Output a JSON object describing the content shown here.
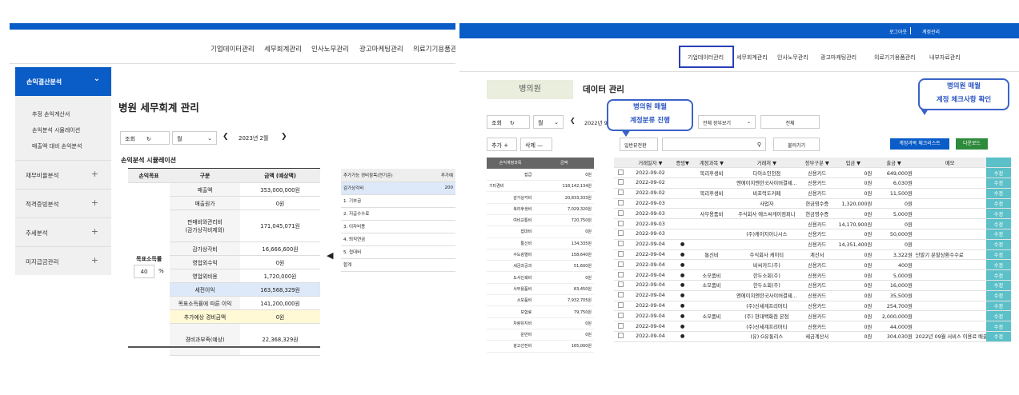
{
  "left": {
    "nav": [
      "기업데이터관리",
      "세무회계관리",
      "인사노무관리",
      "광고마케팅관리",
      "의료기기용품관리"
    ],
    "sidebar": {
      "active": "손익결산분석",
      "sub": [
        "추정 손익계산서",
        "손익분석 시뮬레이션",
        "매출액 대비 손익분석"
      ],
      "sections": [
        "재무비율분석",
        "적격증빙분석",
        "추세분석",
        "미지급금관리"
      ]
    },
    "title": "병원 세무회계 관리",
    "controls": {
      "query": "조회",
      "period": "월",
      "month": "2023년 2월"
    },
    "sim_title": "손익분석 시뮬레이션",
    "sim_headers": [
      "손익목표",
      "구분",
      "금액 (예상액)"
    ],
    "target_label": "목표소득률",
    "target_value": "40",
    "target_unit": "%",
    "sim_rows": [
      [
        "매출액",
        "353,000,000원"
      ],
      [
        "매출원가",
        "0원"
      ],
      [
        "판매비와관리비\n(감가상각비제외)",
        "171,045,071원"
      ],
      [
        "감가상각비",
        "16,666,600원"
      ],
      [
        "영업외수익",
        "0원"
      ],
      [
        "영업외비용",
        "1,720,000원"
      ],
      [
        "세전이익",
        "163,568,329원"
      ],
      [
        "목표소득률에 따른 이익",
        "141,200,000원"
      ],
      [
        "추가예상 경비금액",
        "0원"
      ],
      [
        "경비과부족(예상)",
        "22,368,329원"
      ]
    ],
    "extra_headers": [
      "추가가능 경비항목(연기준)",
      "추가예"
    ],
    "extra_rows": [
      "감가상각비",
      "1. 기부금",
      "2. 지급수수료",
      "3. 이자비용",
      "4. 퇴직연금",
      "5. 접대비",
      "합계"
    ],
    "extra_first_value": "200"
  },
  "right": {
    "logout": "로그아웃",
    "account": "계정관리",
    "nav": [
      "기업데이터관리",
      "세무회계관리",
      "인사노무관리",
      "광고마케팅관리",
      "의료기기용품관리",
      "내부자료관리"
    ],
    "hospital": "병의원",
    "data_title": "데이터 관리",
    "bubble1": [
      "병의원 매월",
      "계정분류 진행"
    ],
    "bubble2": [
      "병의원 매월",
      "계정 체크사항 확인"
    ],
    "controls": {
      "query": "조회",
      "period": "월",
      "month": "2022년 9",
      "voucher": "전체 장부보기",
      "all": "전체",
      "add": "추가 +",
      "delete": "삭제 —",
      "convert": "일반뷰전환",
      "search_btn": "불러가기",
      "check_btn": "계정과목 체크리스트",
      "download": "다운로드"
    },
    "left_headers": [
      "손익계정과목",
      "금액"
    ],
    "left_rows": [
      [
        "접급",
        "0원"
      ],
      [
        "기타경비",
        "118,142,134원"
      ],
      [
        "감가상각비",
        "20,833,333원"
      ],
      [
        "복리후생비",
        "7,029,320원"
      ],
      [
        "여비교통비",
        "720,750원"
      ],
      [
        "접대비",
        "0원"
      ],
      [
        "통신비",
        "134,335원"
      ],
      [
        "수도광열비",
        "158,640원"
      ],
      [
        "세금과공과",
        "51,600원"
      ],
      [
        "도서인쇄비",
        "0원"
      ],
      [
        "사무용품비",
        "83,450원"
      ],
      [
        "소모품비",
        "7,932,705원"
      ],
      [
        "보험료",
        "79,750원"
      ],
      [
        "차량유지비",
        "0원"
      ],
      [
        "운반비",
        "0원"
      ],
      [
        "광고선전비",
        "165,000원"
      ]
    ],
    "headers": [
      "거래일자 ▼",
      "증빙▼",
      "계정과목 ▼",
      "거래처 ▼",
      "장부구분 ▼",
      "입금 ▼",
      "출금 ▼",
      "메모",
      ""
    ],
    "rows": [
      [
        "2022-09-02",
        "",
        "복리후생비",
        "다이소인천점",
        "신용카드",
        "0원",
        "649,000원",
        ""
      ],
      [
        "2022-09-02",
        "",
        "",
        "엔에이치엔한국사이버결제...",
        "신용카드",
        "0원",
        "6,030원",
        ""
      ],
      [
        "2022-09-02",
        "",
        "복리후생비",
        "비포럭도커페",
        "신용카드",
        "0원",
        "11,500원",
        ""
      ],
      [
        "2022-09-03",
        "",
        "",
        "사업자",
        "현금영수증",
        "1,320,000원",
        "0원",
        ""
      ],
      [
        "2022-09-03",
        "",
        "사무용품비",
        "주식회사 에스씨게이컴퍼니",
        "현금영수증",
        "0원",
        "5,000원",
        ""
      ],
      [
        "2022-09-03",
        "",
        "",
        "",
        "신용카드",
        "14,170,900원",
        "0원",
        ""
      ],
      [
        "2022-09-03",
        "",
        "",
        "(주)케이지이니시스",
        "신용카드",
        "0원",
        "50,000원",
        ""
      ],
      [
        "2022-09-04",
        "●",
        "",
        "",
        "신용카드",
        "14,351,400원",
        "0원",
        ""
      ],
      [
        "2022-09-04",
        "●",
        "통신비",
        "주식회사 케이티",
        "계산서",
        "0원",
        "3,322원",
        "단말기 분할상환수수료"
      ],
      [
        "2022-09-04",
        "●",
        "",
        "비씨카드(주)",
        "신용카드",
        "0원",
        "400원",
        ""
      ],
      [
        "2022-09-04",
        "●",
        "소모품비",
        "한두소회(주)",
        "신용카드",
        "0원",
        "5,000원",
        ""
      ],
      [
        "2022-09-04",
        "●",
        "소모품비",
        "한두소회(주)",
        "신용카드",
        "0원",
        "16,000원",
        ""
      ],
      [
        "2022-09-04",
        "●",
        "",
        "엔에이치엔한국사이버결제...",
        "신용카드",
        "0원",
        "35,500원",
        ""
      ],
      [
        "2022-09-04",
        "●",
        "",
        "(주)신세계프리머티",
        "신용카드",
        "0원",
        "254,700원",
        ""
      ],
      [
        "2022-09-04",
        "●",
        "소모품비",
        "(주) 현대백화점 본점",
        "신용카드",
        "0원",
        "2,000,000원",
        ""
      ],
      [
        "2022-09-04",
        "●",
        "",
        "(주)신세계프리머티",
        "신용카드",
        "0원",
        "44,000원",
        ""
      ],
      [
        "2022-09-04",
        "●",
        "",
        "(유) G유통리스",
        "세금계산서",
        "0원",
        "304,030원",
        "2022년 09월 서비스 이용료 배출"
      ]
    ],
    "edit_label": "수정"
  },
  "colors": {
    "primary": "#0a5cc7",
    "teal": "#5bc0c8",
    "green": "#2e8b3c",
    "highlight": "#dde8f8",
    "yellow": "#fff9d6"
  }
}
